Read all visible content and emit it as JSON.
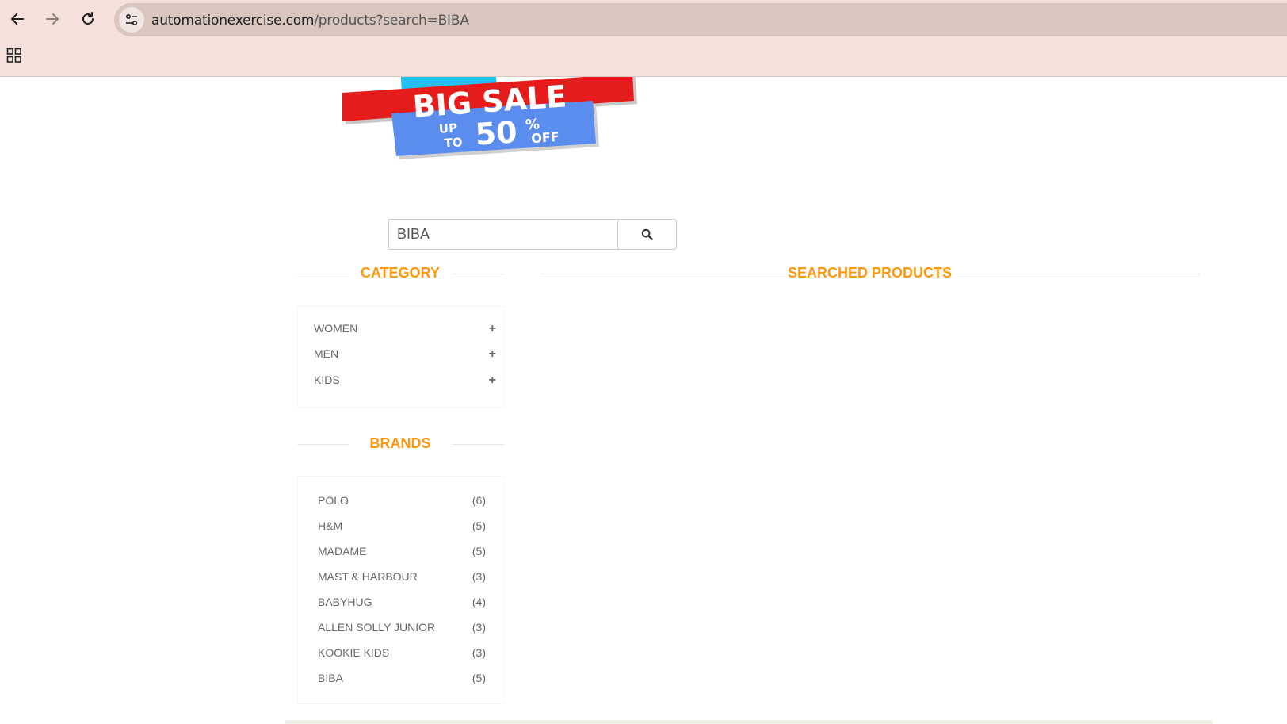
{
  "browser": {
    "url_domain": "automationexercise.com",
    "url_path": "/products?search=BIBA"
  },
  "banner": {
    "line1": "BIG SALE",
    "up": "UP",
    "to": "TO",
    "percent_value": "50",
    "percent_sign": "%",
    "off": "OFF"
  },
  "search": {
    "value": "BIBA"
  },
  "sidebar": {
    "category_title": "Category",
    "categories": [
      {
        "label": "WOMEN",
        "icon": "plus-icon"
      },
      {
        "label": "MEN",
        "icon": "plus-icon"
      },
      {
        "label": "KIDS",
        "icon": "plus-icon"
      }
    ],
    "brands_title": "Brands",
    "brands": [
      {
        "label": "POLO",
        "count": "(6)"
      },
      {
        "label": "H&M",
        "count": "(5)"
      },
      {
        "label": "MADAME",
        "count": "(5)"
      },
      {
        "label": "MAST & HARBOUR",
        "count": "(3)"
      },
      {
        "label": "BABYHUG",
        "count": "(4)"
      },
      {
        "label": "ALLEN SOLLY JUNIOR",
        "count": "(3)"
      },
      {
        "label": "KOOKIE KIDS",
        "count": "(3)"
      },
      {
        "label": "BIBA",
        "count": "(5)"
      }
    ]
  },
  "main": {
    "title": "Searched Products"
  },
  "colors": {
    "accent": "#fe980f",
    "chrome": "#f5e1dc",
    "omnibox": "#d8c6bf",
    "sale_red": "#e51c1c",
    "sale_blue": "#5b8def"
  }
}
